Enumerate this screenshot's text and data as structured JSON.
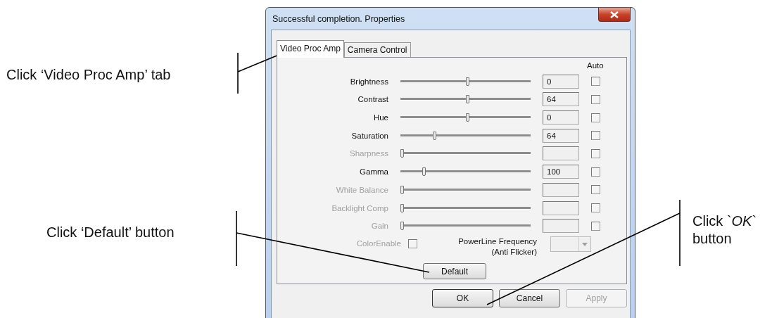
{
  "callouts": [
    {
      "text": "Click ‘Video Proc Amp’ tab"
    },
    {
      "text": "Click ‘Default’ button"
    },
    {
      "text": "Click `*OK*` button"
    }
  ],
  "window": {
    "title": "Successful completion. Properties"
  },
  "tabs": [
    {
      "label": "Video Proc Amp",
      "selected": true
    },
    {
      "label": "Camera Control",
      "selected": false
    }
  ],
  "auto_header": "Auto",
  "properties": [
    {
      "label": "Brightness",
      "level": 0.5,
      "value": "0",
      "disabled": false,
      "auto": false
    },
    {
      "label": "Contrast",
      "level": 0.5,
      "value": "64",
      "disabled": false,
      "auto": false
    },
    {
      "label": "Hue",
      "level": 0.5,
      "value": "0",
      "disabled": false,
      "auto": false
    },
    {
      "label": "Saturation",
      "level": 0.25,
      "value": "64",
      "disabled": false,
      "auto": false
    },
    {
      "label": "Sharpness",
      "level": 0,
      "disabled": true,
      "auto": false
    },
    {
      "label": "Gamma",
      "level": 0.17,
      "value": "100",
      "disabled": false,
      "auto": false
    },
    {
      "label": "White Balance",
      "level": 0,
      "disabled": true,
      "auto": false
    },
    {
      "label": "Backlight Comp",
      "level": 0,
      "disabled": true,
      "auto": false
    },
    {
      "label": "Gain",
      "level": 0,
      "disabled": true,
      "auto": false
    }
  ],
  "color_enable": {
    "label": "ColorEnable",
    "checked": false,
    "disabled": true
  },
  "powerline": {
    "label": "PowerLine Frequency",
    "sublabel": "(Anti Flicker)",
    "disabled": true
  },
  "default_button": {
    "label": "Default"
  },
  "buttons": [
    {
      "label": "OK",
      "disabled": false
    },
    {
      "label": "Cancel",
      "disabled": false
    },
    {
      "label": "Apply",
      "disabled": true
    }
  ]
}
